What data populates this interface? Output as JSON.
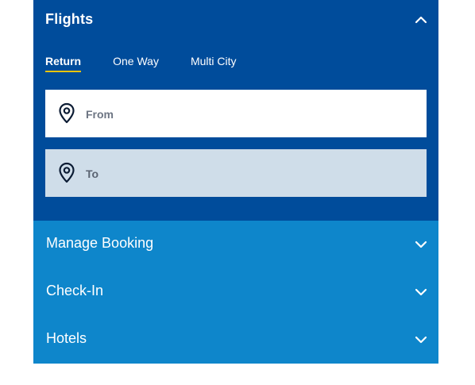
{
  "flights_panel": {
    "title": "Flights",
    "toggle_icon": "chevron-up-icon",
    "tabs": [
      {
        "label": "Return",
        "active": true
      },
      {
        "label": "One Way",
        "active": false
      },
      {
        "label": "Multi City",
        "active": false
      }
    ],
    "from_field": {
      "placeholder": "From",
      "value": "",
      "icon": "location-pin-icon"
    },
    "to_field": {
      "placeholder": "To",
      "value": "",
      "icon": "location-pin-icon"
    }
  },
  "accordion": [
    {
      "label": "Manage Booking",
      "icon": "chevron-down-icon"
    },
    {
      "label": "Check-In",
      "icon": "chevron-down-icon"
    },
    {
      "label": "Hotels",
      "icon": "chevron-down-icon"
    }
  ],
  "colors": {
    "panel_bg": "#004c9b",
    "accordion_bg": "#0e86cb",
    "tab_underline": "#f5c400",
    "to_field_bg": "#cfdde9"
  }
}
